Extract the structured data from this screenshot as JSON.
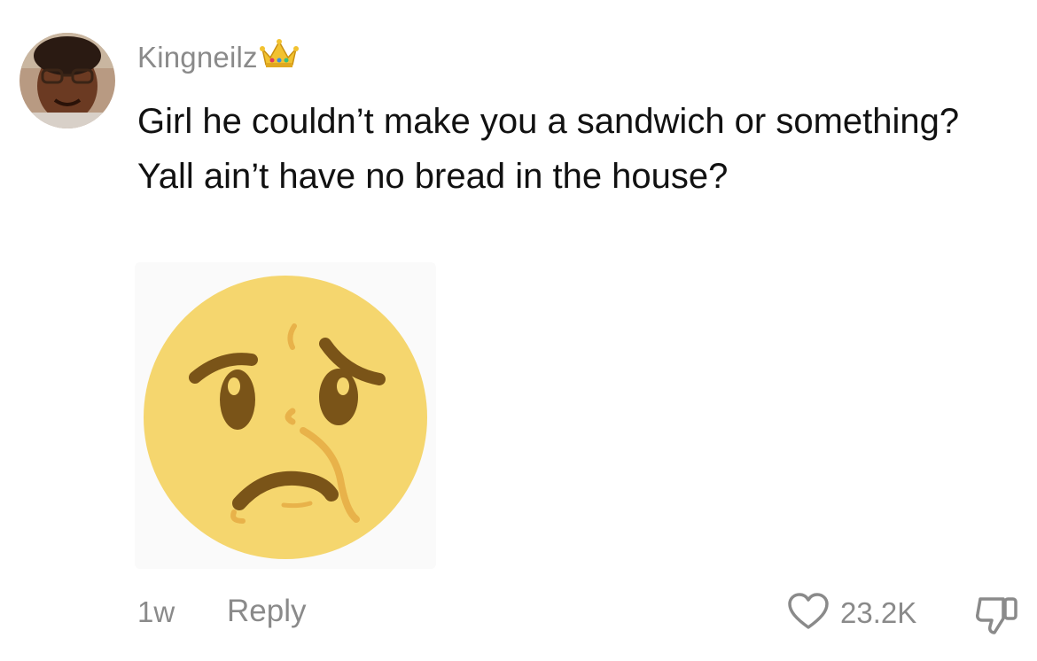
{
  "comment": {
    "username": "Kingneilz",
    "username_badge_icon": "crown-icon",
    "text": "Girl he couldn’t make you a sandwich or something? Yall ain’t have no bread in the house?",
    "sticker_icon": "worried-face-sticker",
    "timestamp": "1w",
    "reply_label": "Reply",
    "like_count": "23.2K",
    "like_icon": "heart-icon",
    "dislike_icon": "thumbs-down-icon"
  },
  "colors": {
    "text_primary": "#111111",
    "text_secondary": "#8a8a8a",
    "sticker_face": "#f5d66e",
    "sticker_features": "#7a5418",
    "sticker_accent": "#e8b24a"
  }
}
